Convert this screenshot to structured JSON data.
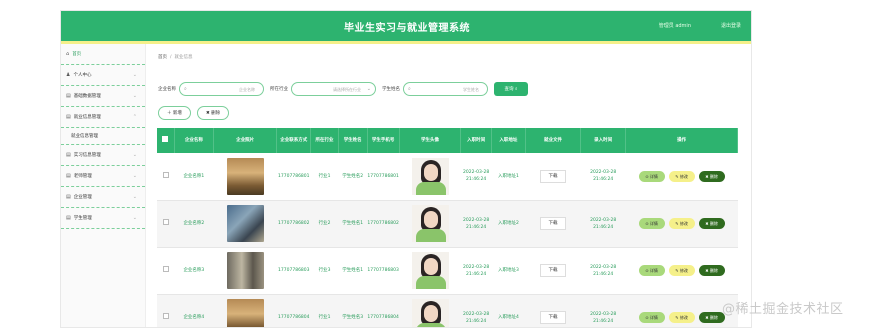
{
  "header": {
    "title": "毕业生实习与就业管理系统",
    "admin": "管理员 admin",
    "logout": "退出登录"
  },
  "sidebar": {
    "items": [
      {
        "label": "首页",
        "icon": "home-icon",
        "glyph": "⌂"
      },
      {
        "label": "个人中心",
        "icon": "user-icon",
        "glyph": "♟"
      },
      {
        "label": "基础数据管理",
        "icon": "list-icon",
        "glyph": "▤"
      },
      {
        "label": "就业信息管理",
        "icon": "list-icon",
        "glyph": "▤"
      },
      {
        "label": "实习信息管理",
        "icon": "list-icon",
        "glyph": "▤"
      },
      {
        "label": "老师管理",
        "icon": "list-icon",
        "glyph": "▤"
      },
      {
        "label": "企业管理",
        "icon": "list-icon",
        "glyph": "▤"
      },
      {
        "label": "学生管理",
        "icon": "list-icon",
        "glyph": "▤"
      }
    ],
    "sub_item": "就业信息管理"
  },
  "breadcrumb": {
    "home": "首页",
    "sep": "/",
    "current": "就业信息"
  },
  "search": {
    "field1_label": "企业名称",
    "field1_placeholder": "企业名称",
    "field2_label": "所在行业",
    "field2_placeholder": "请选择所在行业",
    "field3_label": "学生姓名",
    "field3_placeholder": "学生姓名",
    "button": "查询"
  },
  "actions": {
    "add": "＋ 新增",
    "delete": "✖ 删除"
  },
  "table": {
    "headers": [
      "企业名称",
      "企业照片",
      "企业联系方式",
      "所在行业",
      "学生姓名",
      "学生手机号",
      "学生头像",
      "入职时间",
      "入职地址",
      "就业文件",
      "录入时间",
      "操作"
    ],
    "download": "下载",
    "op_detail": "详情",
    "op_edit": "修改",
    "op_delete": "删除",
    "rows": [
      {
        "company": "企业名称1",
        "phone": "17707786801",
        "industry": "行业1",
        "student": "学生姓名2",
        "sphone": "17707786801",
        "time": "2022-03-28 21:46:24",
        "addr": "入职地址1",
        "created": "2022-03-28 21:46:24",
        "img": "th1"
      },
      {
        "company": "企业名称2",
        "phone": "17707786802",
        "industry": "行业2",
        "student": "学生姓名1",
        "sphone": "17707786802",
        "time": "2022-03-28 21:46:24",
        "addr": "入职地址2",
        "created": "2022-03-28 21:46:24",
        "img": "th2"
      },
      {
        "company": "企业名称3",
        "phone": "17707786803",
        "industry": "行业3",
        "student": "学生姓名1",
        "sphone": "17707786803",
        "time": "2022-03-28 21:46:24",
        "addr": "入职地址3",
        "created": "2022-03-28 21:46:24",
        "img": "th3"
      },
      {
        "company": "企业名称4",
        "phone": "17707786804",
        "industry": "行业1",
        "student": "学生姓名3",
        "sphone": "17707786804",
        "time": "2022-03-28 21:46:24",
        "addr": "入职地址4",
        "created": "2022-03-28 21:46:24",
        "img": "th1"
      }
    ]
  },
  "watermark": "@稀土掘金技术社区",
  "colors": {
    "primary": "#2db36f",
    "accent_yellow": "#f5f08a",
    "dark_green": "#2f6b1f"
  }
}
